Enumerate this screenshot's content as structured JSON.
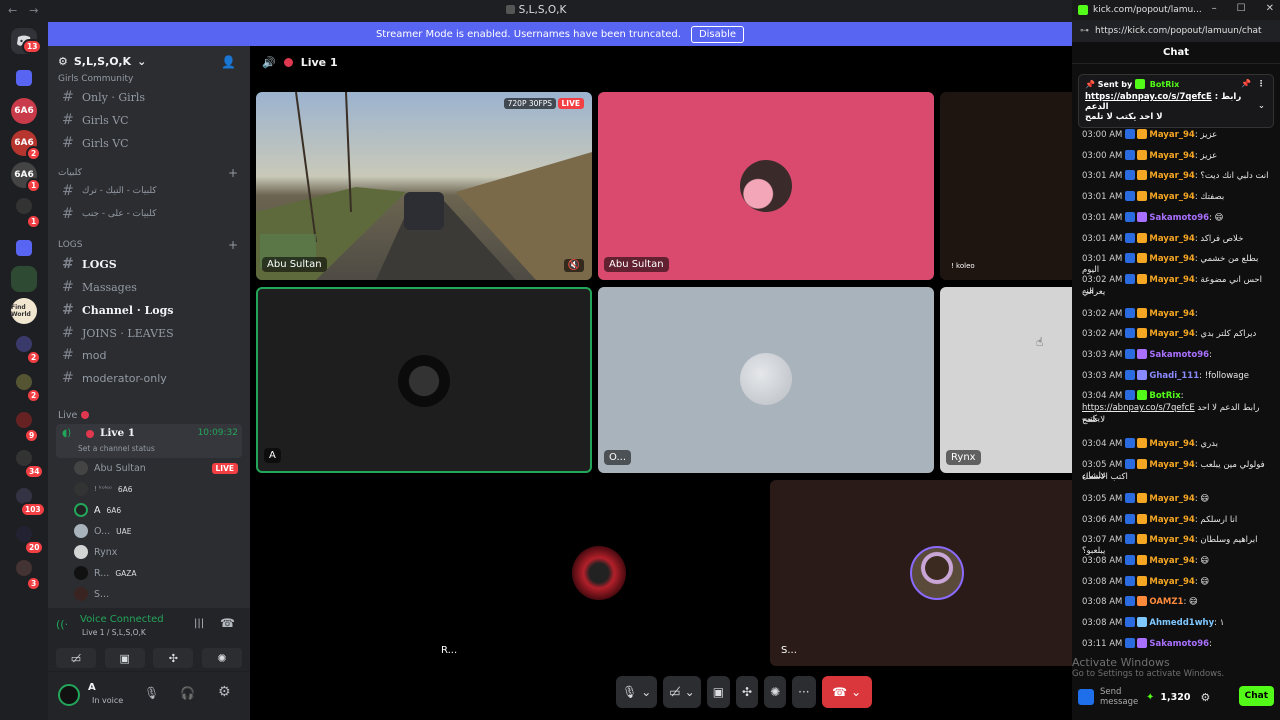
{
  "window": {
    "title": "S,L,S,O,K"
  },
  "banner": {
    "text": "Streamer Mode is enabled. Usernames have been truncated.",
    "button": "Disable"
  },
  "rail": {
    "badges": [
      "13",
      "2",
      "1",
      "1",
      "2",
      "2",
      "9",
      "34",
      "103",
      "20",
      "3"
    ]
  },
  "server": {
    "name": "S,L,S,O,K"
  },
  "channels": {
    "cat_girls": "Girls Community",
    "only_girls": "Only · Girls",
    "girls_vc_1": "Girls VC",
    "girls_vc_2": "Girls VC",
    "cat_kalbiyat": "كلبيات",
    "kalb_1": "كلبيات - التيك - ترك",
    "kalb_2": "كلبيات - على - جنب",
    "cat_logs": "LOGS",
    "logs": "LOGS",
    "massages": "Massages",
    "channel_logs": "Channel · Logs",
    "joins_leaves": "JOINS · LEAVES",
    "mod": "mod",
    "moderator_only": "moderator-only",
    "cat_live": "Live",
    "live_name": "Live 1",
    "live_timer": "10:09:32",
    "live_status": "Set a channel status"
  },
  "voice_users": [
    {
      "name": "Abu Sultan",
      "live": "LIVE"
    },
    {
      "name": "! ᵏᵒˡᵉᵒ",
      "tag": "6A6"
    },
    {
      "name": "A",
      "tag": "6A6"
    },
    {
      "name": "O...",
      "tag": "UAE"
    },
    {
      "name": "Rynx"
    },
    {
      "name": "R...",
      "tag": "GAZA"
    },
    {
      "name": "S..."
    }
  ],
  "voice_panel": {
    "status": "Voice Connected",
    "location": "Live 1 / S,L,S,O,K"
  },
  "user": {
    "name": "A",
    "status": "In voice"
  },
  "call": {
    "title": "Live 1",
    "stream_badge": "720P 30FPS",
    "live_badge": "LIVE",
    "tiles": [
      {
        "name": "Abu Sultan",
        "color": "#2b2b2b"
      },
      {
        "name": "Abu Sultan",
        "color": "#d94a6e"
      },
      {
        "name": "! koleo",
        "color": "#1f1510"
      },
      {
        "name": "A",
        "color": "#1e1e1e"
      },
      {
        "name": "O...",
        "color": "#a9b3bc"
      },
      {
        "name": "Rynx",
        "color": "#d4d4d4"
      },
      {
        "name": "R...",
        "color": "#000000"
      },
      {
        "name": "S...",
        "color": "#2a1a18"
      }
    ]
  },
  "chat": {
    "url_short": "kick.com/popout/lamu...",
    "url": "https://kick.com/popout/lamuun/chat",
    "header": "Chat",
    "pinned": {
      "sent_by": "Sent by",
      "user": "BotRix",
      "link": "https://abnpay.co/s/7qefcE",
      "text": ": رابط الدعم",
      "line2": "لا احد يكتب لا تلمح"
    },
    "messages": [
      {
        "time": "03:00 AM",
        "user": "Mayar_94",
        "color": "#f5a623",
        "text": ": عزيز"
      },
      {
        "time": "03:00 AM",
        "user": "Mayar_94",
        "color": "#f5a623",
        "text": ": عزيز"
      },
      {
        "time": "03:01 AM",
        "user": "Mayar_94",
        "color": "#f5a623",
        "text": ": انت دلبي انك ديت؟"
      },
      {
        "time": "03:01 AM",
        "user": "Mayar_94",
        "color": "#f5a623",
        "text": ": بصفتك"
      },
      {
        "time": "03:01 AM",
        "user": "Sakamoto96",
        "color": "#a970ff",
        "text": ": 😄"
      },
      {
        "time": "03:01 AM",
        "user": "Mayar_94",
        "color": "#f5a623",
        "text": ": خلاص فراكد"
      },
      {
        "time": "03:01 AM",
        "user": "Mayar_94",
        "color": "#f5a623",
        "text": ": بطلع من خشمي اليوم"
      },
      {
        "time": "03:02 AM",
        "user": "Mayar_94",
        "color": "#f5a623",
        "text": ": احس اني مضوعة منه"
      },
      {
        "time": "03:02 AM",
        "user": "Mayar_94",
        "color": "#f5a623",
        "text": ":"
      },
      {
        "time": "03:02 AM",
        "user": "Mayar_94",
        "color": "#f5a623",
        "text": ": ديراكم كلتر بدي"
      },
      {
        "time": "03:03 AM",
        "user": "Sakamoto96",
        "color": "#a970ff",
        "text": ":"
      },
      {
        "time": "03:03 AM",
        "user": "Ghadi_111",
        "color": "#8a8aff",
        "text": ": !followage"
      },
      {
        "time": "03:04 AM",
        "user": "BotRix",
        "color": "#53fc18",
        "text": ":"
      },
      {
        "time": "03:04 AM",
        "user": "Mayar_94",
        "color": "#f5a623",
        "text": ": بدري"
      },
      {
        "time": "03:05 AM",
        "user": "Mayar_94",
        "color": "#f5a623",
        "text": ": فولولي مين يبلعب علشان"
      },
      {
        "time": "03:05 AM",
        "user": "Mayar_94",
        "color": "#f5a623",
        "text": ": 😄"
      },
      {
        "time": "03:06 AM",
        "user": "Mayar_94",
        "color": "#f5a623",
        "text": ": انا ارسلكم"
      },
      {
        "time": "03:07 AM",
        "user": "Mayar_94",
        "color": "#f5a623",
        "text": ": ابراهيم وسلطان يبلعبو؟"
      },
      {
        "time": "03:08 AM",
        "user": "Mayar_94",
        "color": "#f5a623",
        "text": ": 😄"
      },
      {
        "time": "03:08 AM",
        "user": "Mayar_94",
        "color": "#f5a623",
        "text": ": 😄"
      },
      {
        "time": "03:08 AM",
        "user": "OAMZ1",
        "color": "#ff8a3c",
        "text": ": 😄"
      },
      {
        "time": "03:08 AM",
        "user": "Ahmedd1why",
        "color": "#7fc7ff",
        "text": ": ١"
      },
      {
        "time": "03:11 AM",
        "user": "Sakamoto96",
        "color": "#a970ff",
        "text": ":"
      }
    ],
    "botrix_link": "https://abnpay.co/s/7qefcE",
    "botrix_text": "رابط الدعم لا احد يكتب",
    "botrix_line2": "لا تلمح",
    "mayar_line2": "يعرالي",
    "mayar_line2b": "اكتب الاسماء",
    "input_placeholder": "Send message",
    "points": "1,320",
    "send": "Chat",
    "watermark_1": "Activate Windows",
    "watermark_2": "Go to Settings to activate Windows."
  }
}
